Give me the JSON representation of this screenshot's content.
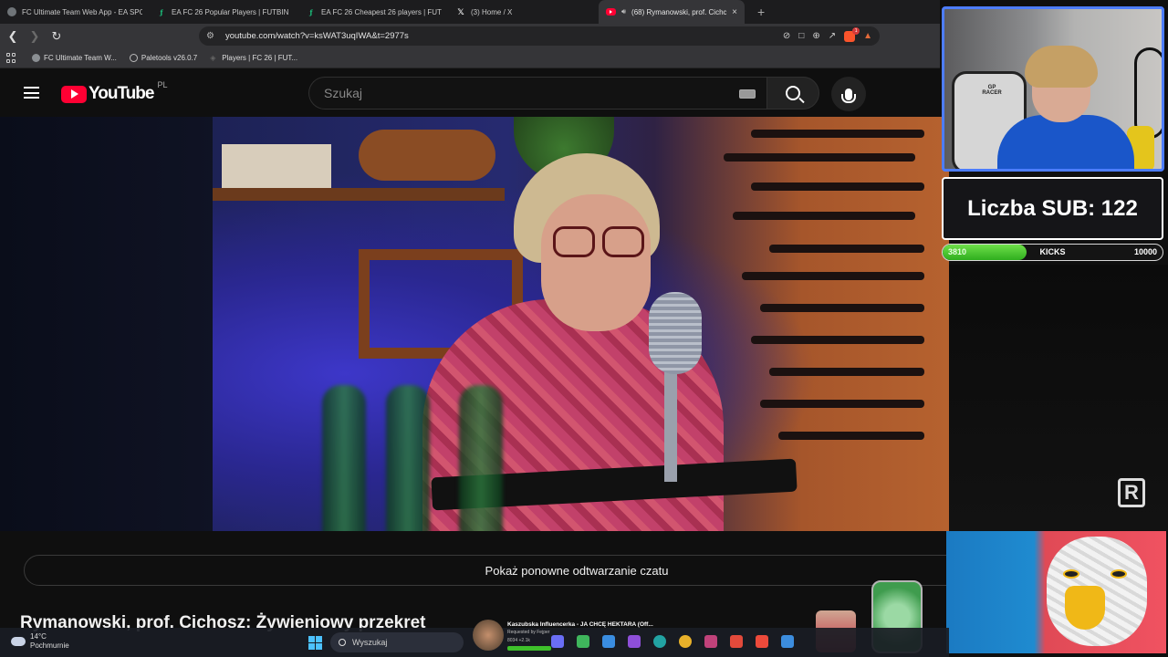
{
  "browser": {
    "tabs": [
      {
        "label": "FC Ultimate Team Web App - EA SPO",
        "icon": "globe-icon",
        "active": false
      },
      {
        "label": "EA FC 26 Popular Players | FUTBIN",
        "icon": "futbin-icon",
        "active": false
      },
      {
        "label": "EA FC 26 Cheapest 26 players | FUTBI",
        "icon": "futbin-icon",
        "active": false
      },
      {
        "label": "(3) Home / X",
        "icon": "x-icon",
        "active": false
      },
      {
        "label": "(68) Rymanowski, prof. Cichc",
        "icon": "youtube-icon",
        "active": true
      }
    ],
    "new_tab": "+",
    "close_glyph": "×",
    "url": "youtube.com/watch?v=ksWAT3uqIWA&t=2977s",
    "brave_badge": "1",
    "bookmarks": [
      {
        "label": "FC Ultimate Team W...",
        "icon": "globe-icon"
      },
      {
        "label": "Paletools v26.0.7",
        "icon": "paletools-icon"
      },
      {
        "label": "Players | FC 26 | FUT...",
        "icon": "page-icon"
      }
    ]
  },
  "youtube": {
    "logo_text": "YouTube",
    "country_code": "PL",
    "search_placeholder": "Szukaj",
    "chat_replay_label": "Pokaż ponowne odtwarzanie czatu",
    "video_title": "Rymanowski, prof. Cichosz: Żywieniowy przekret"
  },
  "overlay": {
    "sub_counter": "Liczba SUB: 122",
    "kicks": {
      "current": "3810",
      "label": "KICKS",
      "goal": "10000",
      "progress": 0.381
    },
    "webcam_chair_logo": "GP RACER",
    "r_logo": "R"
  },
  "now_playing": {
    "title": "Kaszubska Influencerka - JA CHCĘ HEKTARA (Off...",
    "requested_by": "Requested by Fejper",
    "stats": "8034  +2.1k"
  },
  "taskbar": {
    "temperature": "14°C",
    "weather": "Pochmurnie",
    "search_placeholder": "Wyszukaj",
    "icon_colors": [
      "#6a6ef5",
      "#3fb65c",
      "#3a8de0",
      "#8e4fd9",
      "#22a3a3",
      "#e8b12a",
      "#c0427a",
      "#e24a3b",
      "#ec4a3b",
      "#3c8dde"
    ]
  }
}
